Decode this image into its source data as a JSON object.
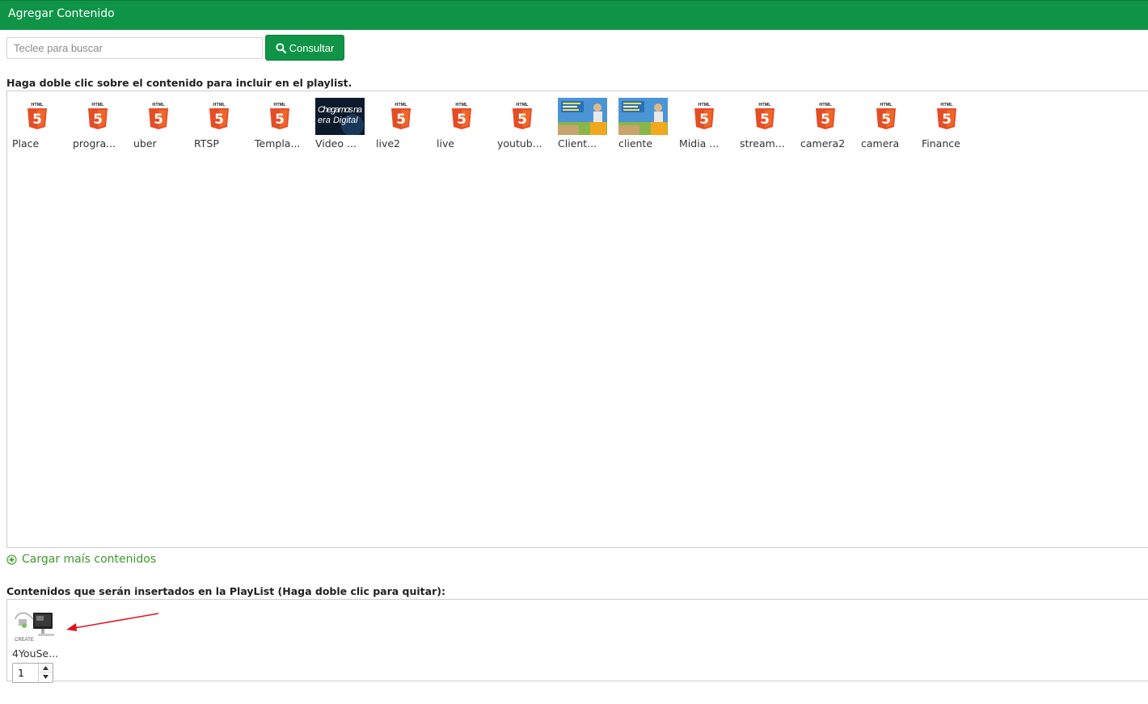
{
  "header": {
    "title": "Agregar Contenido"
  },
  "search": {
    "placeholder": "Teclee para buscar",
    "value": "",
    "button_label": "Consultar"
  },
  "instructions": {
    "content": "Haga doble clic sobre el contenido para incluir en el playlist.",
    "playlist": "Contenidos que serán insertados en la PlayList (Haga doble clic para quitar):"
  },
  "content_items": [
    {
      "label": "Place",
      "type": "html5"
    },
    {
      "label": "progra...",
      "type": "html5"
    },
    {
      "label": "uber",
      "type": "html5"
    },
    {
      "label": "RTSP",
      "type": "html5"
    },
    {
      "label": "Templa...",
      "type": "html5"
    },
    {
      "label": "Video ...",
      "type": "video",
      "thumb_text_1": "Chegamos na",
      "thumb_text_2": "era Digital"
    },
    {
      "label": "live2",
      "type": "html5"
    },
    {
      "label": "live",
      "type": "html5"
    },
    {
      "label": "youtub...",
      "type": "html5"
    },
    {
      "label": "Client...",
      "type": "image"
    },
    {
      "label": "cliente",
      "type": "image"
    },
    {
      "label": "Midia ...",
      "type": "html5"
    },
    {
      "label": "stream...",
      "type": "html5"
    },
    {
      "label": "camera2",
      "type": "html5"
    },
    {
      "label": "camera",
      "type": "html5"
    },
    {
      "label": "Finance",
      "type": "html5"
    }
  ],
  "html5_badge": "HTML",
  "html5_digit": "5",
  "load_more": {
    "label": "Cargar maís contenidos"
  },
  "playlist": {
    "items": [
      {
        "label": "4YouSe...",
        "quantity": "1",
        "thumb_caption": "CREATE"
      }
    ]
  },
  "colors": {
    "header": "#0f9447",
    "button": "#0f9447",
    "html5": "#e44d26",
    "link": "#3d9a2b",
    "arrow": "#e0141e"
  }
}
